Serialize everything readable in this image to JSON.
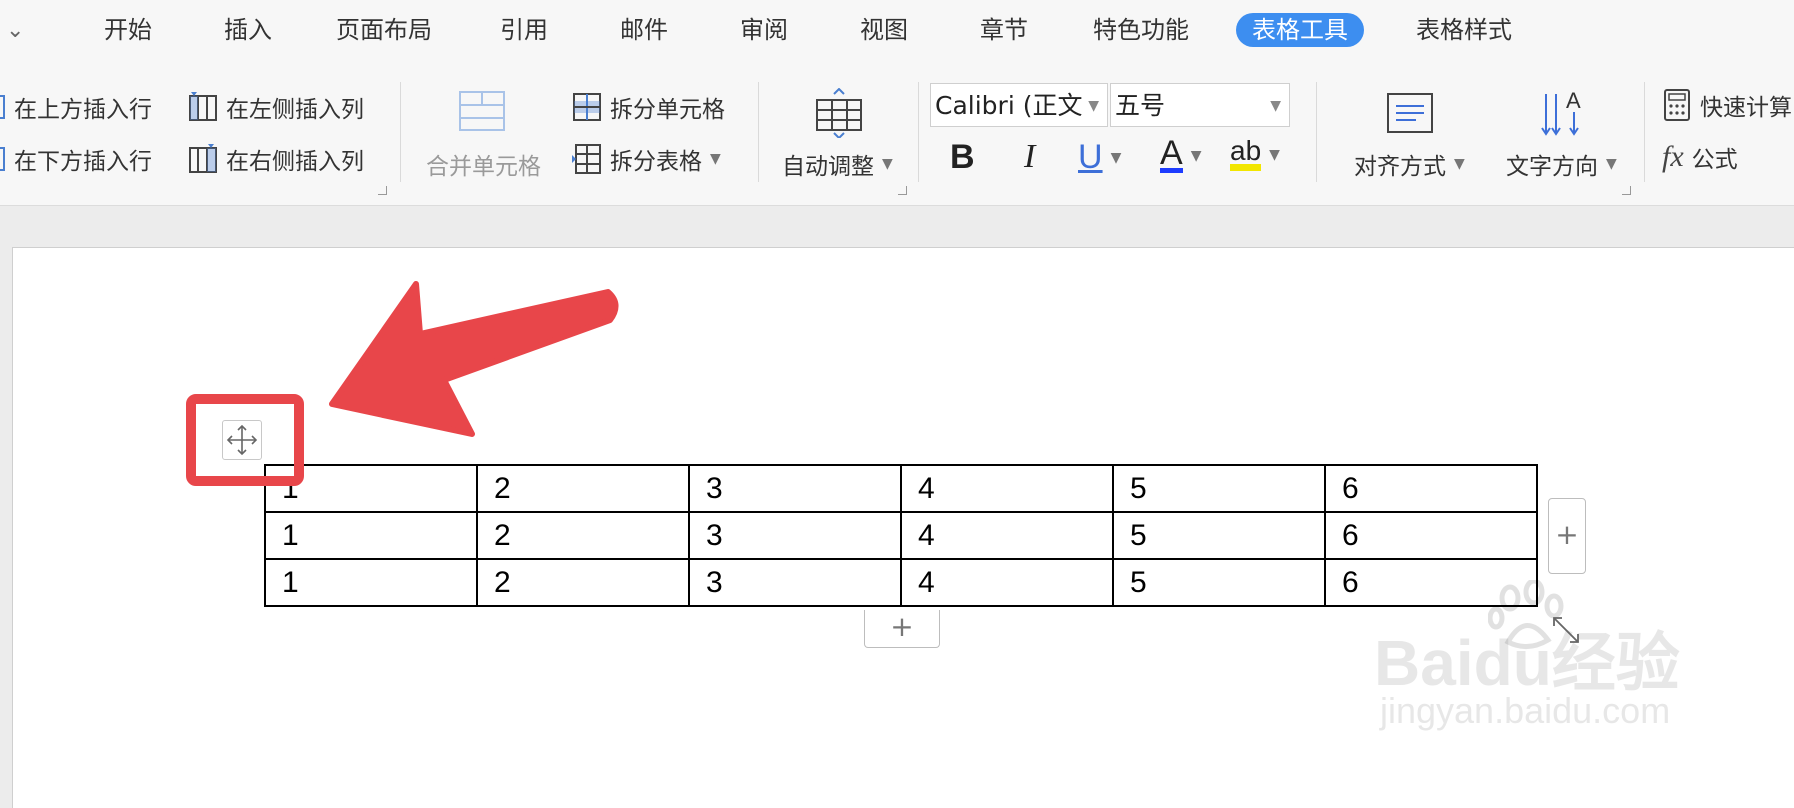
{
  "tabs": [
    {
      "label": "开始"
    },
    {
      "label": "插入"
    },
    {
      "label": "页面布局"
    },
    {
      "label": "引用"
    },
    {
      "label": "邮件"
    },
    {
      "label": "审阅"
    },
    {
      "label": "视图"
    },
    {
      "label": "章节"
    },
    {
      "label": "特色功能"
    },
    {
      "label": "表格工具"
    },
    {
      "label": "表格样式"
    }
  ],
  "active_tab": "表格工具",
  "ribbon": {
    "insert_row_above": "在上方插入行",
    "insert_row_below": "在下方插入行",
    "insert_col_left": "在左侧插入列",
    "insert_col_right": "在右侧插入列",
    "merge_cells": "合并单元格",
    "split_cells": "拆分单元格",
    "split_table": "拆分表格",
    "auto_fit": "自动调整",
    "font_name": "Calibri (正文",
    "font_size": "五号",
    "bold": "B",
    "italic": "I",
    "underline": "U",
    "font_color": "A",
    "highlight": "ab",
    "align": "对齐方式",
    "text_direction": "文字方向",
    "quick_calc": "快速计算",
    "formula_icon": "fx",
    "formula": "公式"
  },
  "table": {
    "rows": [
      [
        "1",
        "2",
        "3",
        "4",
        "5",
        "6"
      ],
      [
        "1",
        "2",
        "3",
        "4",
        "5",
        "6"
      ],
      [
        "1",
        "2",
        "3",
        "4",
        "5",
        "6"
      ]
    ]
  },
  "add_column_symbol": "+",
  "add_row_symbol": "+",
  "watermark": {
    "main": "Baidu经验",
    "sub": "jingyan.baidu.com"
  },
  "colors": {
    "active_tab": "#3d8ef0",
    "annotation": "#e8464a",
    "font_color_bar": "#1e3cff",
    "highlight_bar": "#f2e600"
  }
}
